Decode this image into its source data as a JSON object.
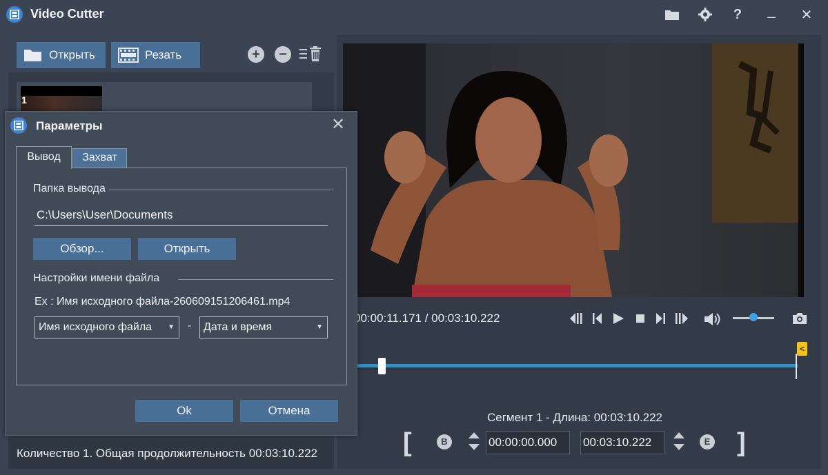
{
  "window": {
    "title": "Video Cutter"
  },
  "titlebar": {
    "folder_icon": "folder-icon",
    "settings_icon": "gear-icon",
    "help_label": "?",
    "minimize_label": "_",
    "close_label": "✕"
  },
  "left_toolbar": {
    "open_label": "Открыть",
    "cut_label": "Резать",
    "add_icon": "plus-circle-icon",
    "remove_icon": "minus-circle-icon",
    "clear_icon": "list-trash-icon"
  },
  "file_list": {
    "items": [
      {
        "index": "1"
      }
    ]
  },
  "status": {
    "text": "Количество 1. Общая продолжительность 00:03:10.222"
  },
  "player": {
    "time": "00:00:11.171 / 00:03:10.222",
    "volume_fraction": 0.5
  },
  "segment": {
    "label": "Сегмент 1 - Длина: 00:03:10.222",
    "begin_letter": "B",
    "end_letter": "E",
    "start": "00:00:00.000",
    "end": "00:03:10.222",
    "left_bracket": "[",
    "right_bracket": "]"
  },
  "dialog": {
    "title": "Параметры",
    "close_label": "✕",
    "tabs": [
      {
        "label": "Вывод"
      },
      {
        "label": "Захват"
      }
    ],
    "output_folder_label": "Папка вывода",
    "output_folder_value": "C:\\Users\\User\\Documents",
    "browse_label": "Обзор...",
    "open_label": "Открыть",
    "filename_settings_label": "Настройки имени файла",
    "example": "Ex : Имя исходного файла-260609151206461.mp4",
    "name_part1": "Имя исходного файла",
    "separator": "-",
    "name_part2": "Дата и время",
    "ok_label": "Ok",
    "cancel_label": "Отмена"
  },
  "colors": {
    "accent": "#3b82d6",
    "button": "#4a6f96",
    "timeline": "#2f8fc9",
    "end_marker": "#f3c21b"
  }
}
